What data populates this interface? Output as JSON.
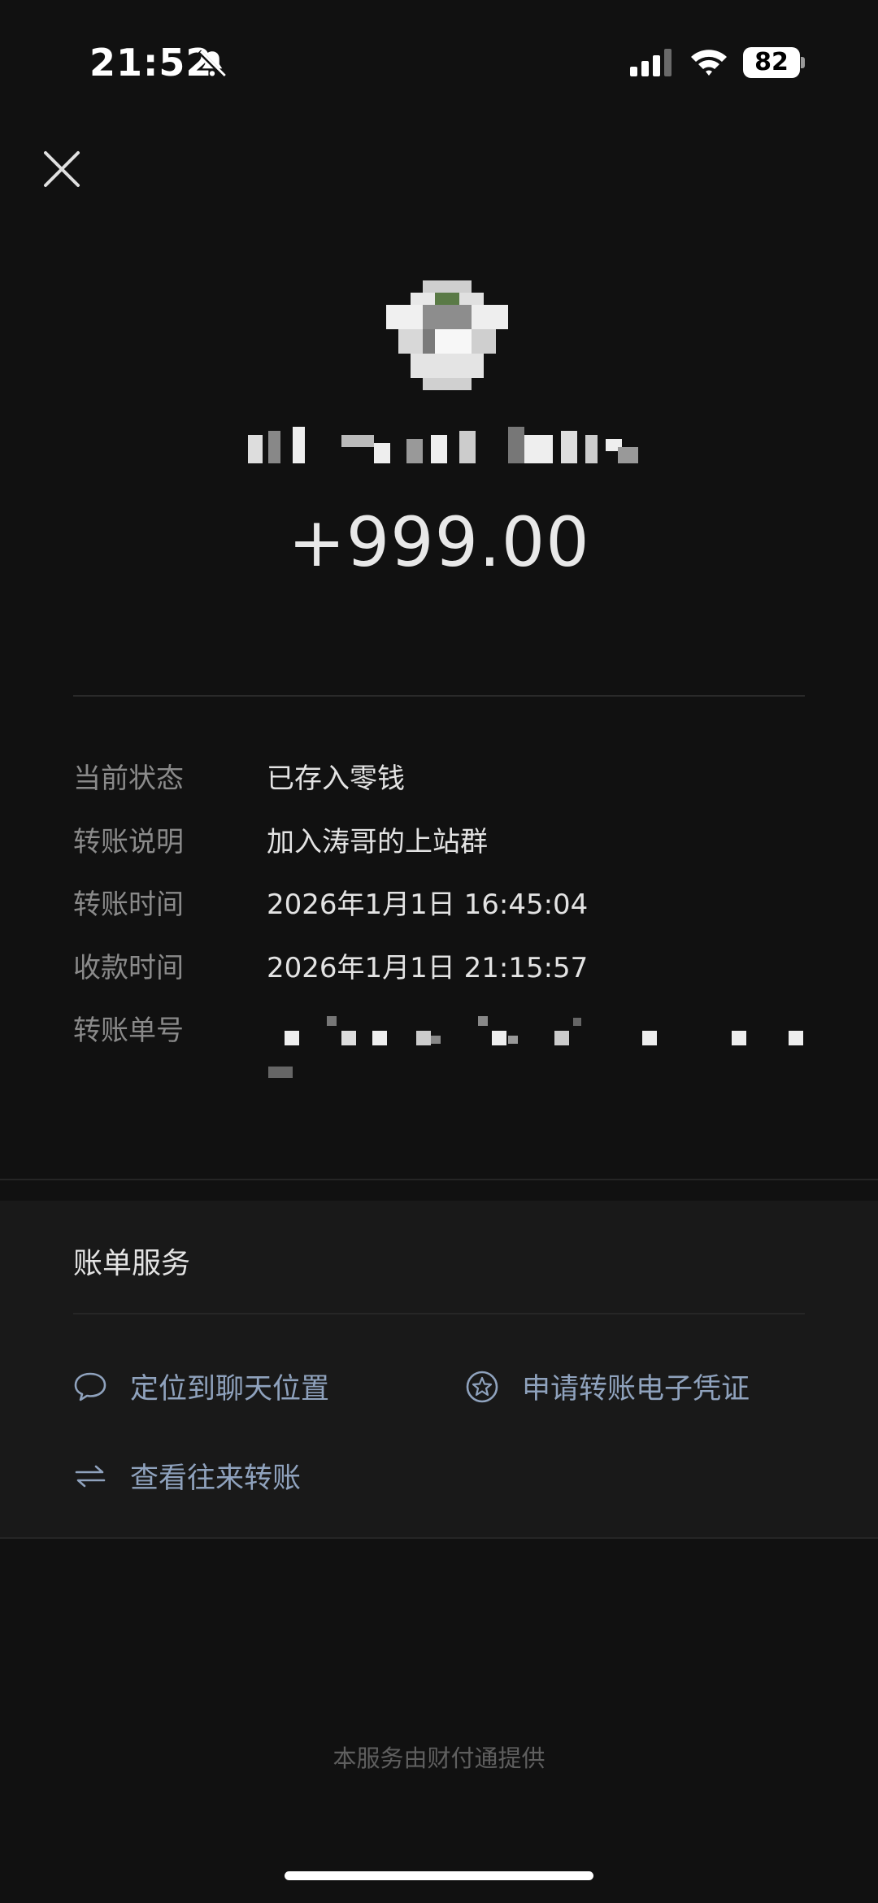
{
  "status_bar": {
    "time": "21:52",
    "battery": "82"
  },
  "transfer": {
    "amount": "+999.00",
    "details": [
      {
        "label": "当前状态",
        "value": "已存入零钱"
      },
      {
        "label": "转账说明",
        "value": "加入涛哥的上站群"
      },
      {
        "label": "转账时间",
        "value": "2026年1月1日 16:45:04"
      },
      {
        "label": "收款时间",
        "value": "2026年1月1日 21:15:57"
      },
      {
        "label": "转账单号",
        "value": ""
      }
    ]
  },
  "bill_service": {
    "title": "账单服务",
    "locate_chat": "定位到聊天位置",
    "apply_receipt": "申请转账电子凭证",
    "view_history": "查看往来转账"
  },
  "footer": "本服务由财付通提供",
  "icons": {
    "close": "close-icon",
    "bell_off": "bell-slash-icon",
    "signal": "cellular-signal-icon",
    "wifi": "wifi-icon",
    "chat": "chat-bubble-icon",
    "certificate": "star-badge-icon",
    "swap": "swap-arrows-icon"
  }
}
